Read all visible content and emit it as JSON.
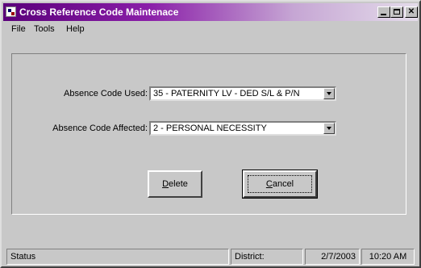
{
  "window": {
    "title": "Cross Reference Code Maintenace"
  },
  "menu": {
    "items": [
      "File",
      "Tools",
      "Help"
    ]
  },
  "form": {
    "used_label": "Absence Code Used:",
    "used_value": "35 - PATERNITY LV - DED S/L & P/N",
    "affected_label": "Absence Code Affected:",
    "affected_value": "2 - PERSONAL NECESSITY"
  },
  "buttons": {
    "delete_first": "D",
    "delete_rest": "elete",
    "cancel_first": "C",
    "cancel_rest": "ancel"
  },
  "statusbar": {
    "status": "Status",
    "district": "District:",
    "date": "2/7/2003",
    "time": "10:20 AM"
  }
}
